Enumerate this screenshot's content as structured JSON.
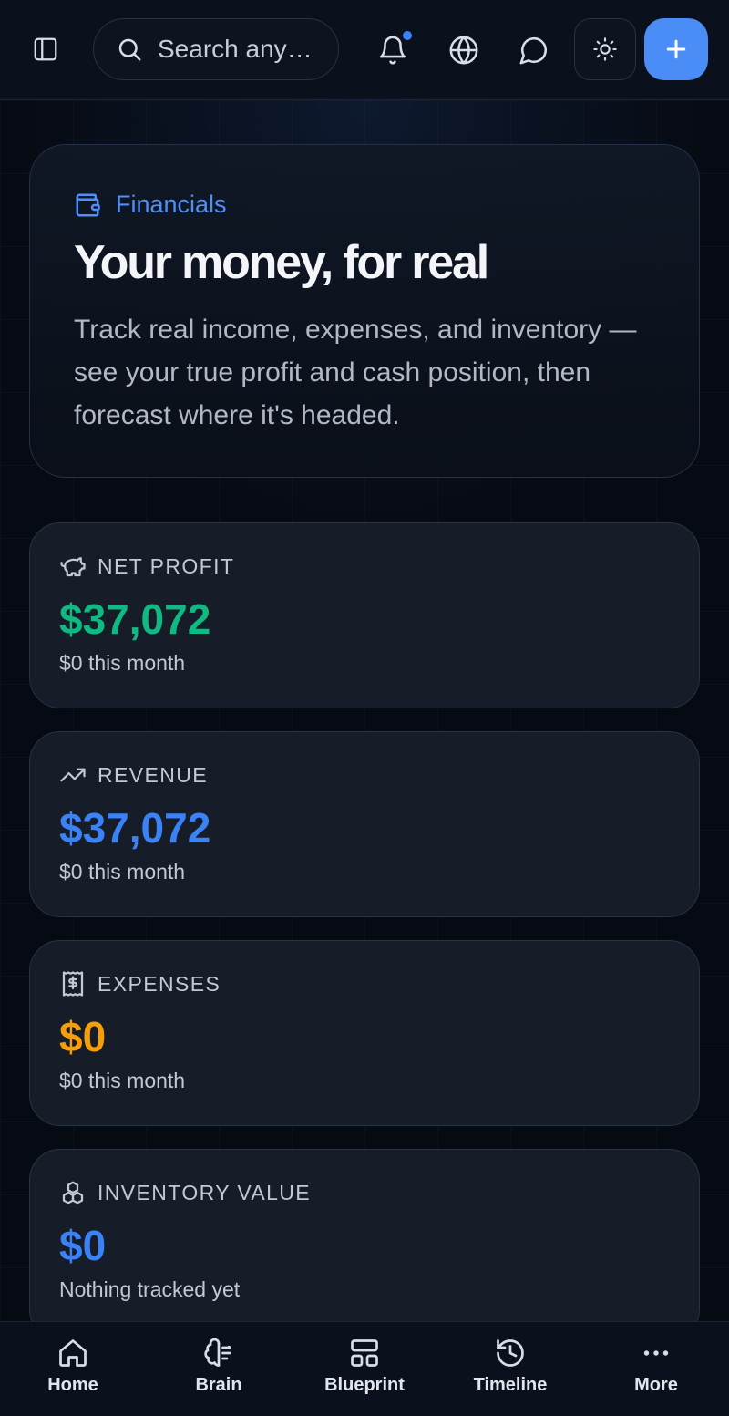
{
  "header": {
    "search_placeholder": "Search any…",
    "icons": [
      "sidebar-toggle-icon",
      "search-icon",
      "bell-icon",
      "globe-icon",
      "chat-icon",
      "sun-icon",
      "plus-icon"
    ],
    "notification_dot_color": "#3b82f6",
    "add_button_color": "#4a8df7"
  },
  "hero": {
    "eyebrow": "Financials",
    "title": "Your money, for real",
    "description": "Track real income, expenses, and inventory — see your true profit and cash position, then forecast where it's headed."
  },
  "stats": [
    {
      "label": "NET PROFIT",
      "value": "$37,072",
      "sub": "$0 this month",
      "icon": "piggy-bank-icon",
      "color": "#10b981"
    },
    {
      "label": "REVENUE",
      "value": "$37,072",
      "sub": "$0 this month",
      "icon": "trending-up-icon",
      "color": "#3b82f6"
    },
    {
      "label": "EXPENSES",
      "value": "$0",
      "sub": "$0 this month",
      "icon": "receipt-icon",
      "color": "#f59e0b"
    },
    {
      "label": "INVENTORY VALUE",
      "value": "$0",
      "sub": "Nothing tracked yet",
      "icon": "boxes-icon",
      "color": "#3b82f6"
    }
  ],
  "nav": [
    {
      "label": "Home",
      "icon": "home-icon"
    },
    {
      "label": "Brain",
      "icon": "brain-icon"
    },
    {
      "label": "Blueprint",
      "icon": "layout-icon"
    },
    {
      "label": "Timeline",
      "icon": "history-icon"
    },
    {
      "label": "More",
      "icon": "more-icon"
    }
  ]
}
